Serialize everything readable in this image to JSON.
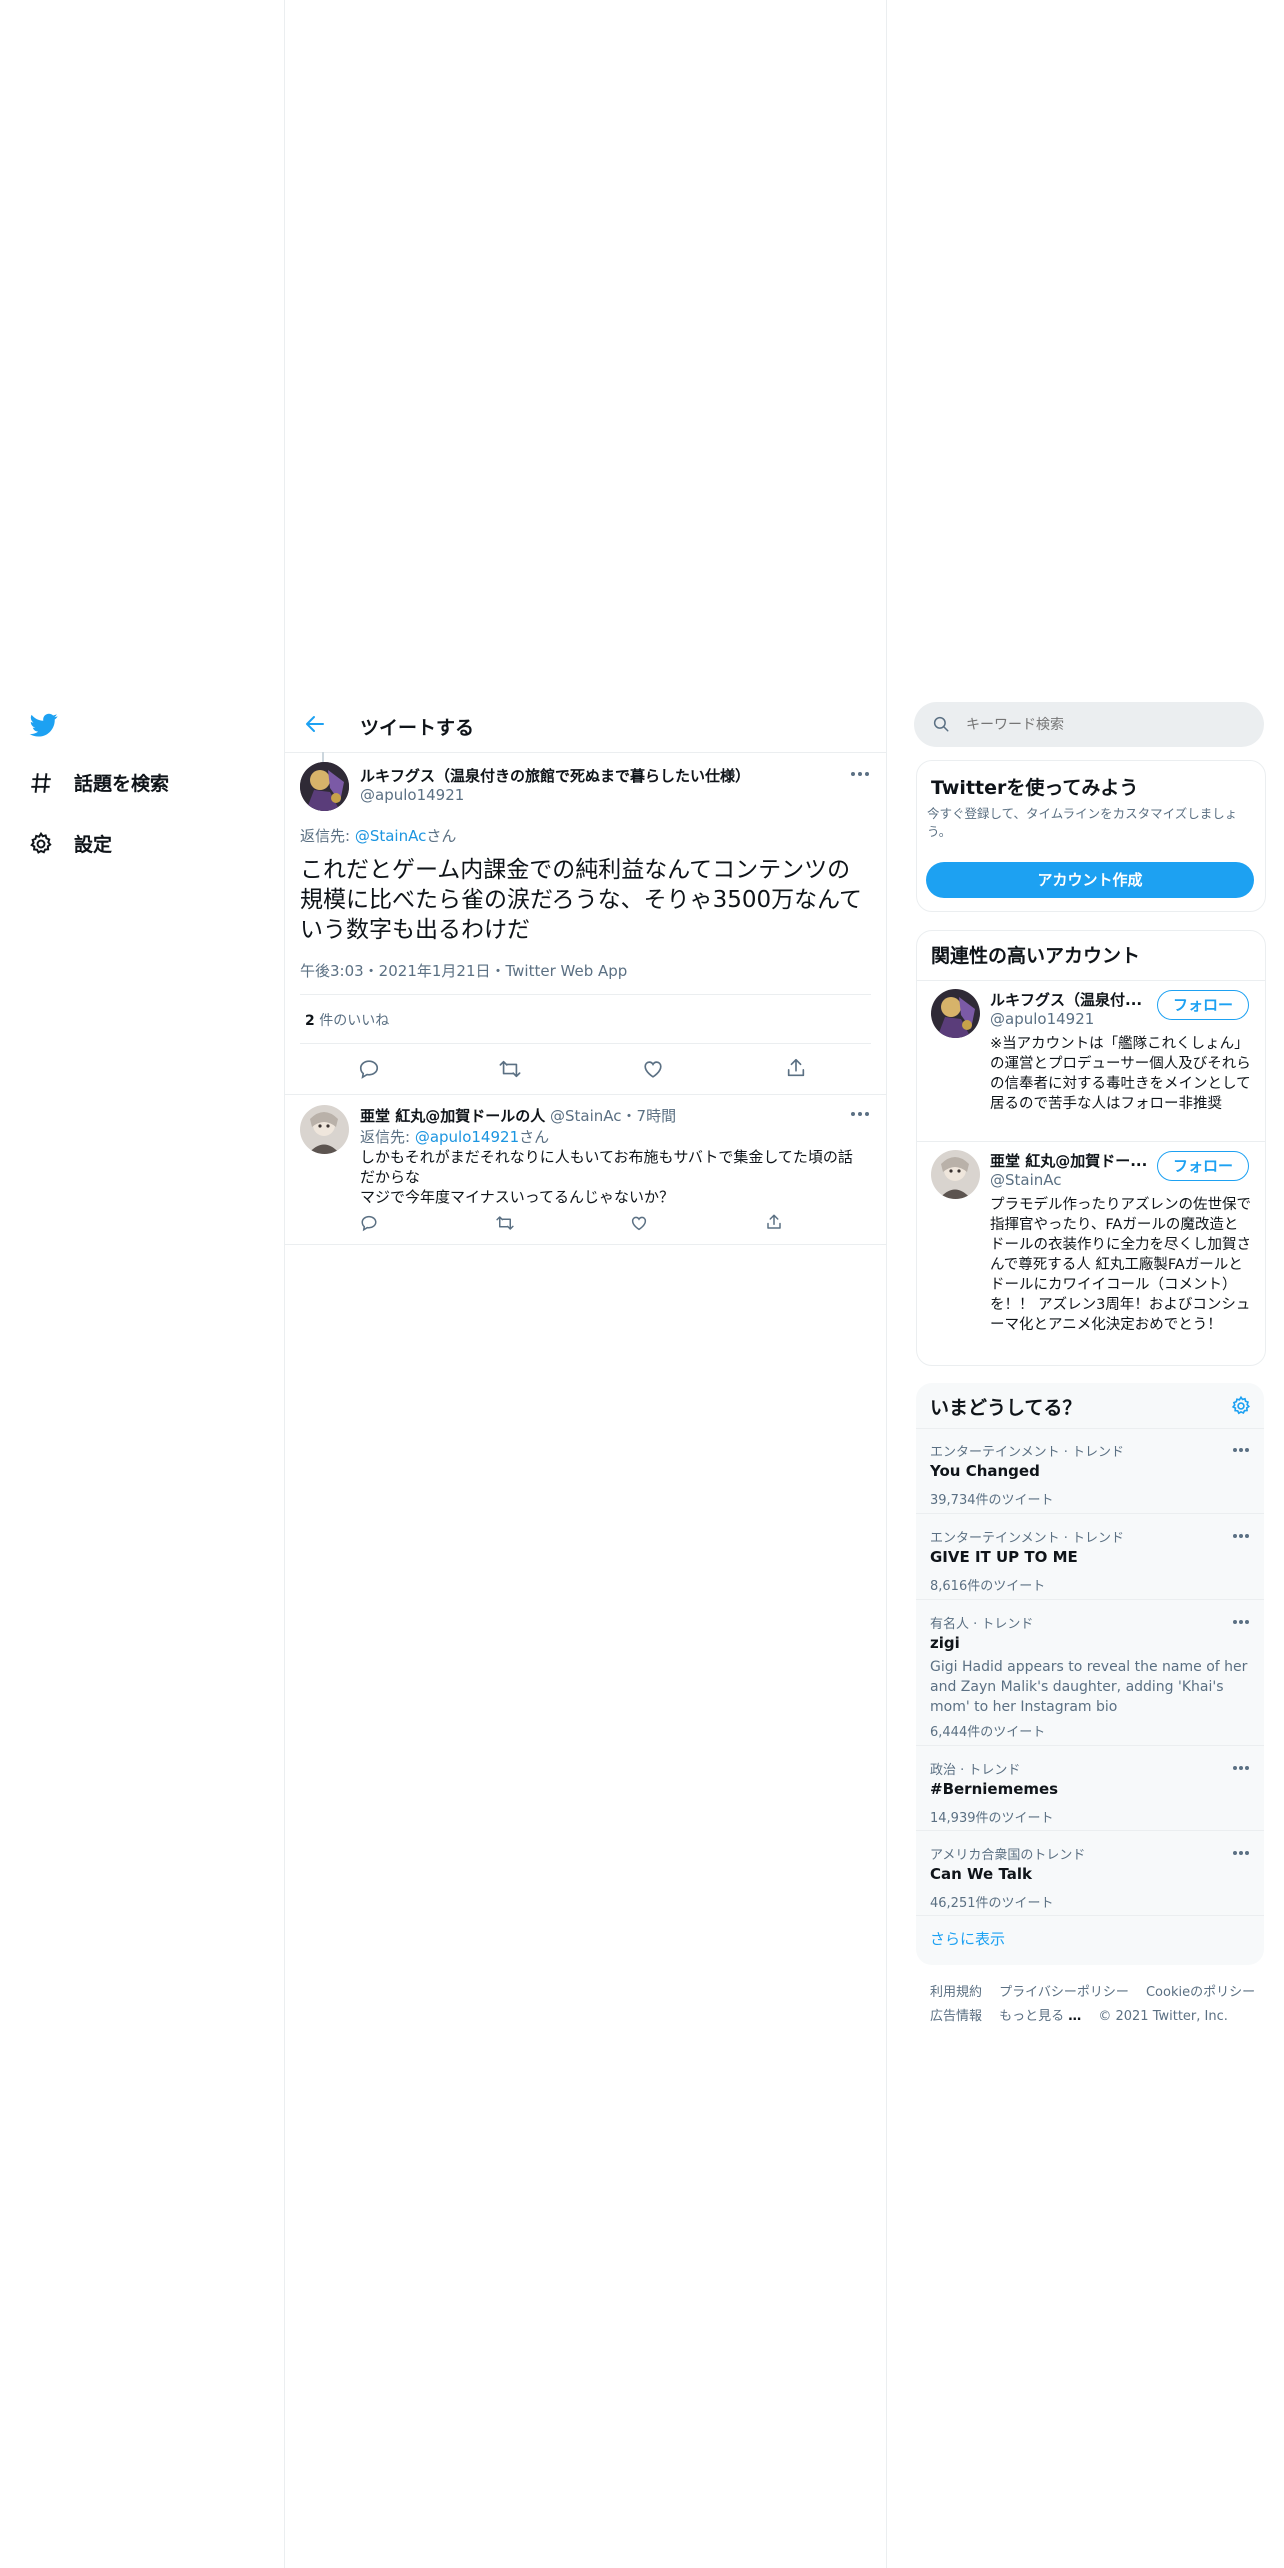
{
  "nav": {
    "items": [
      {
        "label": "話題を検索",
        "icon": "hashtag-icon"
      },
      {
        "label": "設定",
        "icon": "gear-icon"
      }
    ]
  },
  "header": {
    "title": "ツイートする"
  },
  "tweet": {
    "author_name": "ルキフグス（温泉付きの旅館で死ぬまで暮らしたい仕様）",
    "author_handle": "@apulo14921",
    "reply_prefix": "返信先: ",
    "reply_to": "@StainAc",
    "reply_suffix": "さん",
    "text": "これだとゲーム内課金での純利益なんてコンテンツの規模に比べたら雀の涙だろうな、そりゃ3500万なんていう数字も出るわけだ",
    "meta": "午後3:03・2021年1月21日・Twitter Web App",
    "likes_count": "2",
    "likes_label": " 件のいいね"
  },
  "reply": {
    "author_name": "亜堂 紅丸@加賀ドールの人",
    "author_handle": "@StainAc",
    "time": "・7時間",
    "reply_prefix": "返信先: ",
    "reply_to": "@apulo14921",
    "reply_suffix": "さん",
    "text_line1": "しかもそれがまだそれなりに人もいてお布施もサバトで集金してた頃の話だからな",
    "text_line2": "マジで今年度マイナスいってるんじゃないか？"
  },
  "search": {
    "placeholder": "キーワード検索"
  },
  "signup": {
    "title": "Twitterを使ってみよう",
    "desc": "今すぐ登録して、タイムラインをカスタマイズしましょう。",
    "button": "アカウント作成"
  },
  "related": {
    "title": "関連性の高いアカウント",
    "accounts": [
      {
        "name": "ルキフグス（温泉付...",
        "handle": "@apulo14921",
        "follow": "フォロー",
        "bio": "※当アカウントは「艦隊これくしょん」の運営とプロデューサー個人及びそれらの信奉者に対する毒吐きをメインとして居るので苦手な人はフォロー非推奨"
      },
      {
        "name": "亜堂 紅丸@加賀ドー...",
        "handle": "@StainAc",
        "follow": "フォロー",
        "bio": "プラモデル作ったりアズレンの佐世保で指揮官やったり、FAガールの魔改造とドールの衣装作りに全力を尽くし加賀さんで尊死する人 紅丸工廠製FAガールとドールにカワイイコール（コメント）を！！ アズレン3周年！およびコンシューマ化とアニメ化決定おめでとう！"
      }
    ]
  },
  "trends": {
    "title": "いまどうしてる？",
    "items": [
      {
        "category": "エンターテインメント · トレンド",
        "title": "You Changed",
        "desc": "",
        "count": "39,734件のツイート"
      },
      {
        "category": "エンターテインメント · トレンド",
        "title": "GIVE IT UP TO ME",
        "desc": "",
        "count": "8,616件のツイート"
      },
      {
        "category": "有名人 · トレンド",
        "title": "zigi",
        "desc": "Gigi Hadid appears to reveal the name of her and Zayn Malik's daughter, adding 'Khai's mom' to her Instagram bio",
        "count": "6,444件のツイート"
      },
      {
        "category": "政治 · トレンド",
        "title": "#Berniememes",
        "desc": "",
        "count": "14,939件のツイート"
      },
      {
        "category": "アメリカ合衆国のトレンド",
        "title": "Can We Talk",
        "desc": "",
        "count": "46,251件のツイート"
      }
    ],
    "show_more": "さらに表示"
  },
  "footer": {
    "links": [
      "利用規約",
      "プライバシーポリシー",
      "Cookieのポリシー",
      "広告情報",
      "もっと見る"
    ],
    "copyright": "© 2021 Twitter, Inc."
  },
  "colors": {
    "accent": "#1da1f2",
    "link": "#1b95e0",
    "muted": "#5b7083",
    "border": "#ebeef0"
  }
}
